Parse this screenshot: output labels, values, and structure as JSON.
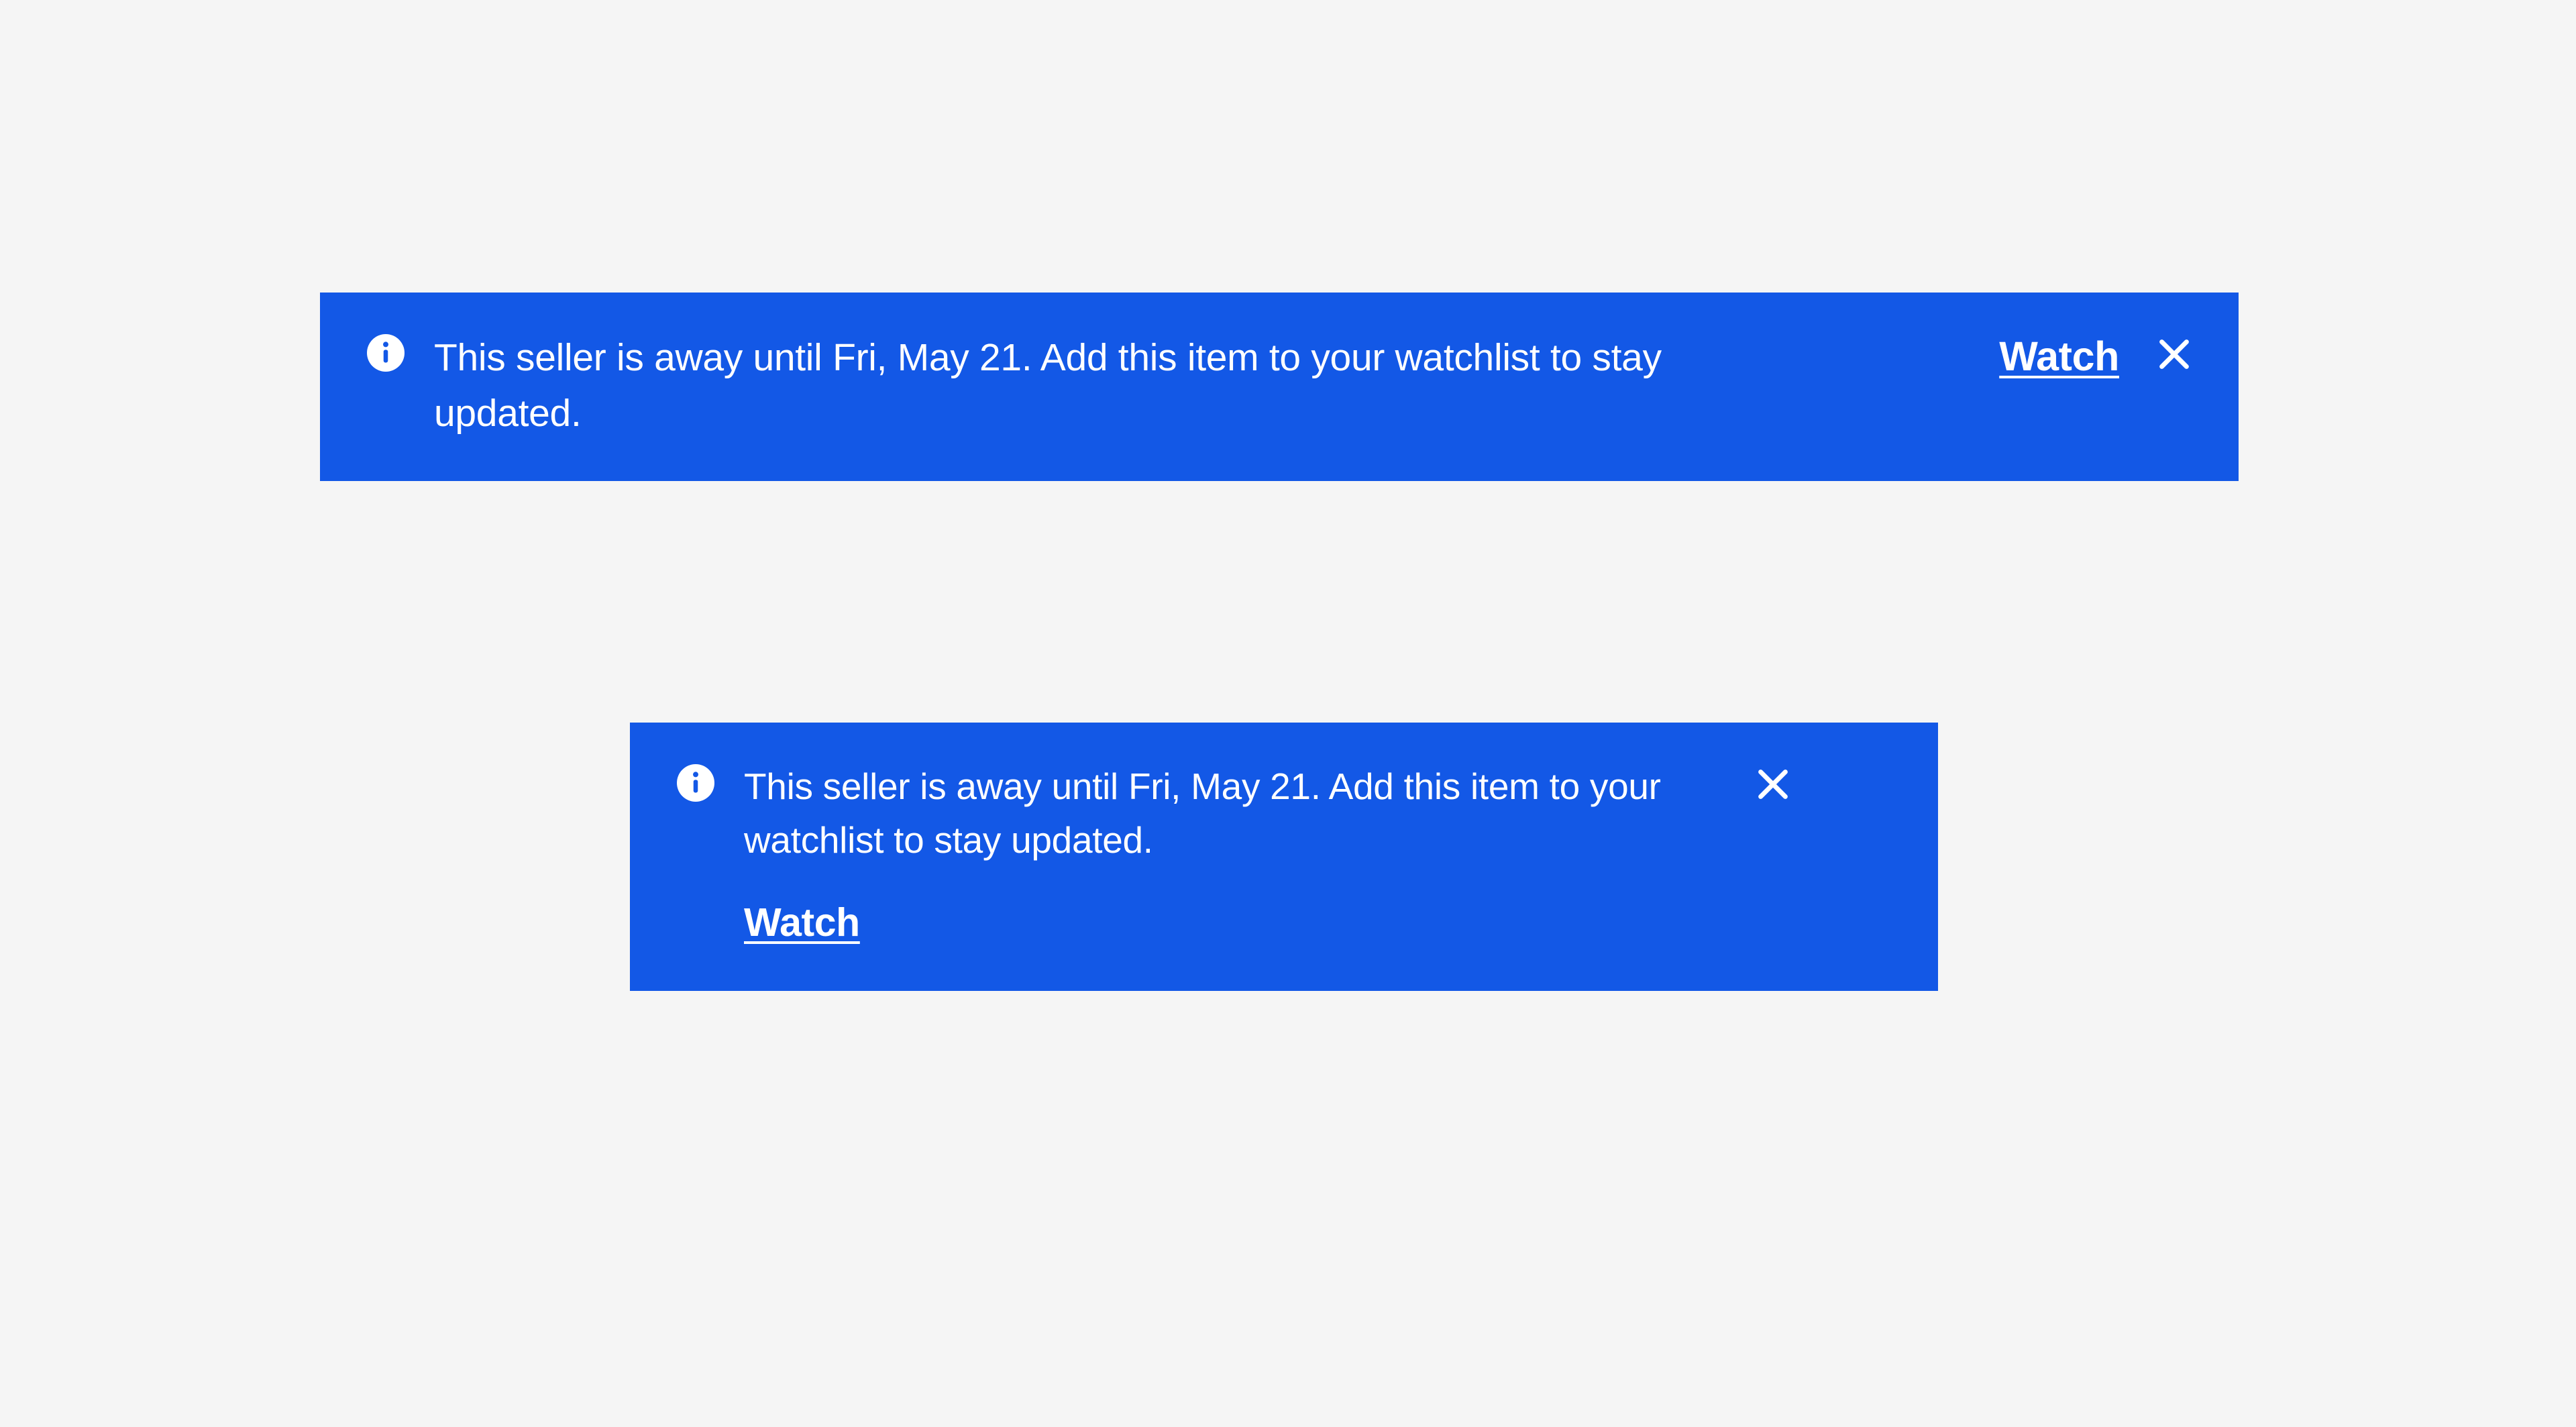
{
  "colors": {
    "background": "#f5f5f5",
    "notice_bg": "#1358e6",
    "notice_text": "#ffffff"
  },
  "notices": {
    "wide": {
      "message": "This seller is away until Fri, May 21. Add this item to your watchlist to stay updated.",
      "action_label": "Watch"
    },
    "narrow": {
      "message": "This seller is away until Fri, May 21. Add this item to your watchlist to stay updated.",
      "action_label": "Watch"
    }
  },
  "icons": {
    "info": "info-icon",
    "close": "close-icon"
  }
}
